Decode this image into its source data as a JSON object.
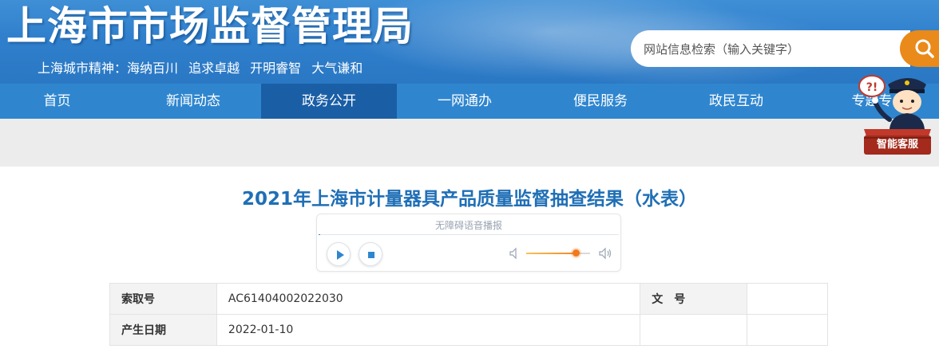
{
  "header": {
    "title": "上海市市场监督管理局",
    "slogan": "上海城市精神：海纳百川  追求卓越  开明睿智  大气谦和",
    "search_placeholder": "网站信息检索（输入关键字）",
    "search_icon": "search-icon"
  },
  "nav": {
    "items": [
      {
        "label": "首页"
      },
      {
        "label": "新闻动态"
      },
      {
        "label": "政务公开",
        "active": true
      },
      {
        "label": "一网通办"
      },
      {
        "label": "便民服务"
      },
      {
        "label": "政民互动"
      },
      {
        "label": "专题专"
      }
    ]
  },
  "service": {
    "label": "智能客服",
    "bubble": "?!"
  },
  "article": {
    "title": "2021年上海市计量器具产品质量监督抽查结果（水表）"
  },
  "player": {
    "label": "无障碍语音播报",
    "volume_level": 0.78
  },
  "meta_table": {
    "rows": [
      {
        "k1": "索取号",
        "v1": "AC61404002022030",
        "k2": "文　号",
        "v2": ""
      },
      {
        "k1": "产生日期",
        "v1": "2022-01-10",
        "k2": "",
        "v2": ""
      }
    ]
  },
  "colors": {
    "brand_blue": "#2f86cf",
    "nav_active": "#1a5ea6",
    "title_blue": "#1f6fb6",
    "search_orange": "#e98a1a",
    "service_red": "#a32a1c"
  }
}
